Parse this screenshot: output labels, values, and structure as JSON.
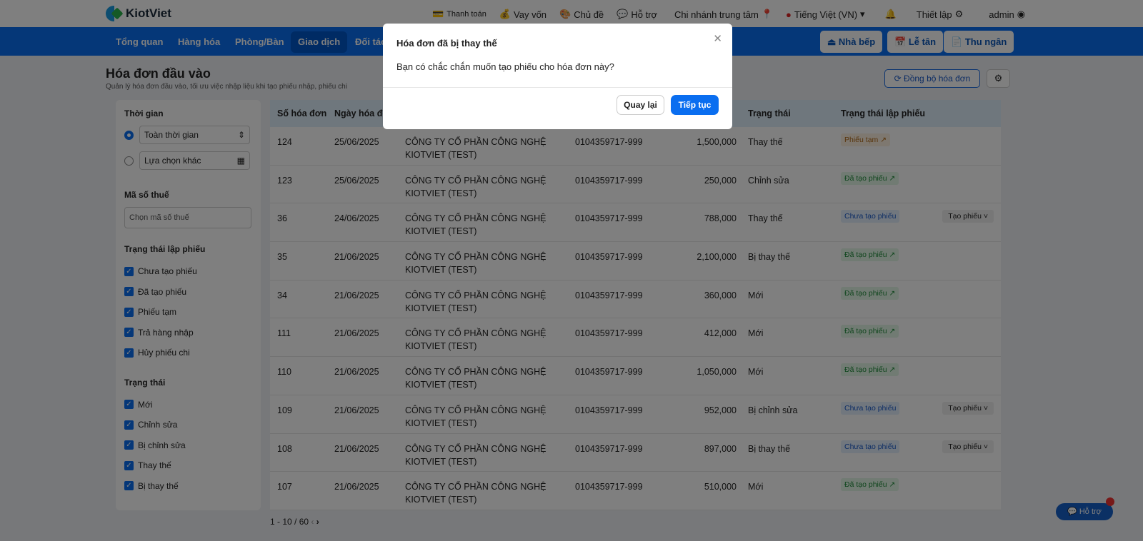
{
  "brand": "KiotViet",
  "topbar": {
    "links": [
      "Thanh toán",
      "Vay vốn",
      "Chủ đề",
      "Hỗ trợ",
      "Chi nhánh trung tâm",
      "Tiếng Việt (VN)",
      "Thiết lập",
      "admin"
    ]
  },
  "nav": {
    "items": [
      "Tổng quan",
      "Hàng hóa",
      "Phòng/Bàn",
      "Giao dịch",
      "Đối tác"
    ],
    "buttons": [
      "Nhà bếp",
      "Lễ tân",
      "Thu ngân"
    ]
  },
  "page": {
    "title": "Hóa đơn đầu vào",
    "subtitle": "Quản lý hóa đơn đầu vào, tối ưu việc nhập liệu khi tạo phiếu nhập, phiếu chi",
    "sync": "Đồng bộ hóa đơn"
  },
  "filters": {
    "time_label": "Thời gian",
    "time_all": "Toàn thời gian",
    "time_other": "Lựa chọn khác",
    "tax_label": "Mã số thuế",
    "tax_placeholder": "Chọn mã số thuế",
    "slip_label": "Trạng thái lập phiếu",
    "slip_options": [
      "Chưa tạo phiếu",
      "Đã tạo phiếu",
      "Phiếu tạm",
      "Trả hàng nhập",
      "Hủy phiếu chi"
    ],
    "status_label": "Trạng thái",
    "status_options": [
      "Mới",
      "Chỉnh sửa",
      "Bị chỉnh sửa",
      "Thay thế",
      "Bị thay thế"
    ]
  },
  "table": {
    "headers": [
      "Số hóa đơn",
      "Ngày hóa đơn",
      "Trạng thái",
      "Trạng thái lập phiếu"
    ],
    "action": "Tạo phiếu",
    "rows": [
      {
        "no": "124",
        "date": "25/06/2025",
        "company": "CÔNG TY CỔ PHẦN CÔNG NGHỆ",
        "company2": "KIOTVIET (TEST)",
        "tax": "0104359717-999",
        "amount": "1,500,000",
        "status": "Thay thế",
        "slip": "Phiếu tạm",
        "kind": "tam"
      },
      {
        "no": "123",
        "date": "25/06/2025",
        "company": "CÔNG TY CỔ PHẦN CÔNG NGHỆ",
        "company2": "KIOTVIET (TEST)",
        "tax": "0104359717-999",
        "amount": "250,000",
        "status": "Chỉnh sửa",
        "slip": "Đã tạo phiếu",
        "kind": "da"
      },
      {
        "no": "36",
        "date": "24/06/2025",
        "company": "CÔNG TY CỔ PHẦN CÔNG NGHỆ",
        "company2": "KIOTVIET (TEST)",
        "tax": "0104359717-999",
        "amount": "788,000",
        "status": "Thay thế",
        "slip": "Chưa tạo phiếu",
        "kind": "chua"
      },
      {
        "no": "35",
        "date": "21/06/2025",
        "company": "CÔNG TY CỔ PHẦN CÔNG NGHỆ",
        "company2": "KIOTVIET (TEST)",
        "tax": "0104359717-999",
        "amount": "2,100,000",
        "status": "Bị thay thế",
        "slip": "Đã tạo phiếu",
        "kind": "da"
      },
      {
        "no": "34",
        "date": "21/06/2025",
        "company": "CÔNG TY CỔ PHẦN CÔNG NGHỆ",
        "company2": "KIOTVIET (TEST)",
        "tax": "0104359717-999",
        "amount": "360,000",
        "status": "Mới",
        "slip": "Đã tạo phiếu",
        "kind": "da"
      },
      {
        "no": "111",
        "date": "21/06/2025",
        "company": "CÔNG TY CỔ PHẦN CÔNG NGHỆ",
        "company2": "KIOTVIET (TEST)",
        "tax": "0104359717-999",
        "amount": "412,000",
        "status": "Mới",
        "slip": "Đã tạo phiếu",
        "kind": "da"
      },
      {
        "no": "110",
        "date": "21/06/2025",
        "company": "CÔNG TY CỔ PHẦN CÔNG NGHỆ",
        "company2": "KIOTVIET (TEST)",
        "tax": "0104359717-999",
        "amount": "1,050,000",
        "status": "Mới",
        "slip": "Đã tạo phiếu",
        "kind": "da"
      },
      {
        "no": "109",
        "date": "21/06/2025",
        "company": "CÔNG TY CỔ PHẦN CÔNG NGHỆ",
        "company2": "KIOTVIET (TEST)",
        "tax": "0104359717-999",
        "amount": "952,000",
        "status": "Bị chỉnh sửa",
        "slip": "Chưa tạo phiếu",
        "kind": "chua"
      },
      {
        "no": "108",
        "date": "21/06/2025",
        "company": "CÔNG TY CỔ PHẦN CÔNG NGHỆ",
        "company2": "KIOTVIET (TEST)",
        "tax": "0104359717-999",
        "amount": "897,000",
        "status": "Bị thay thế",
        "slip": "Chưa tạo phiếu",
        "kind": "chua"
      },
      {
        "no": "107",
        "date": "21/06/2025",
        "company": "CÔNG TY CỔ PHẦN CÔNG NGHỆ",
        "company2": "KIOTVIET (TEST)",
        "tax": "0104359717-999",
        "amount": "510,000",
        "status": "Mới",
        "slip": "Đã tạo phiếu",
        "kind": "da"
      }
    ]
  },
  "pagination": "1 - 10 / 60",
  "help": "Hỗ trợ",
  "modal": {
    "title": "Hóa đơn đã bị thay thế",
    "body": "Bạn có chắc chắn muốn tạo phiếu cho hóa đơn này?",
    "back": "Quay lại",
    "continue": "Tiếp tục"
  }
}
